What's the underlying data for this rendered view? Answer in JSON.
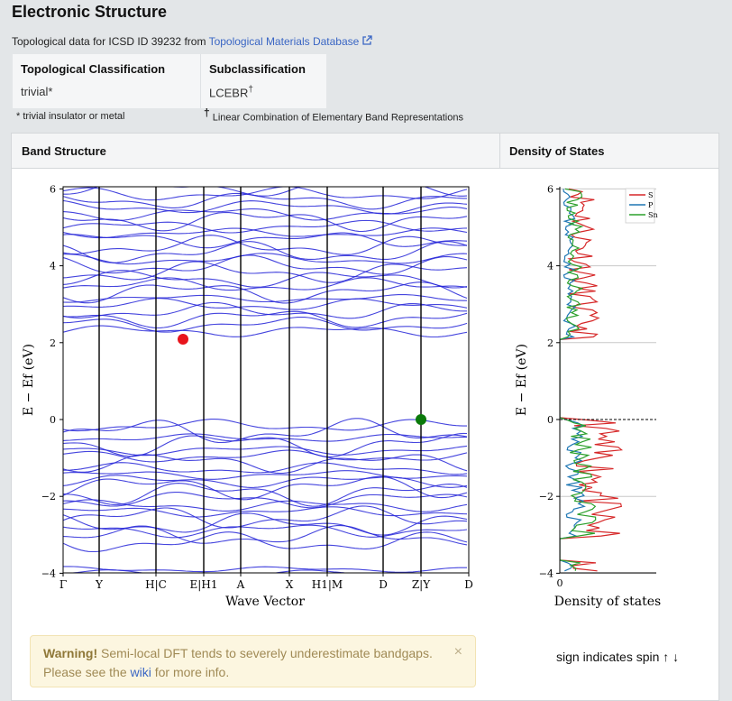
{
  "header": {
    "title": "Electronic Structure",
    "topo_prefix": "Topological data for ICSD ID 39232 from ",
    "topo_link": "Topological Materials Database"
  },
  "classification": {
    "col1_head": "Topological Classification",
    "col1_value": "trivial*",
    "col2_head": "Subclassification",
    "col2_value": "LCEBR",
    "col2_sup": "†",
    "note1": "* trivial insulator or metal",
    "note2_sup": "†",
    "note2": " Linear Combination of Elementary Band Representations"
  },
  "panels": {
    "band_title": "Band Structure",
    "dos_title": "Density of States"
  },
  "band_plot": {
    "ylabel": "E − Ef (eV)",
    "xlabel": "Wave Vector",
    "yticks": [
      "6",
      "4",
      "2",
      "0",
      "−2",
      "−4"
    ],
    "xticks": [
      "Γ",
      "Y",
      "H|C",
      "E|H1",
      "A",
      "X",
      "H1|M",
      "D",
      "Z|Y",
      "D"
    ],
    "cbm_color": "#e8141c",
    "vbm_color": "#0b7a0b",
    "band_color": "#2424d8"
  },
  "dos_plot": {
    "ylabel": "E − Ef (eV)",
    "xlabel": "Density of states",
    "yticks": [
      "6",
      "4",
      "2",
      "0",
      "−2",
      "−4"
    ],
    "xtick": "0",
    "legend": [
      "S",
      "P",
      "Sn"
    ],
    "colors": {
      "S": "#d62728",
      "P": "#1f77b4",
      "Sn": "#2ca02c"
    }
  },
  "warning": {
    "bold": "Warning!",
    "text": " Semi-local DFT tends to severely underestimate bandgaps. Please see the ",
    "link": "wiki",
    "tail": " for more info.",
    "close": "×"
  },
  "spin_note": "sign indicates spin ↑ ↓"
}
